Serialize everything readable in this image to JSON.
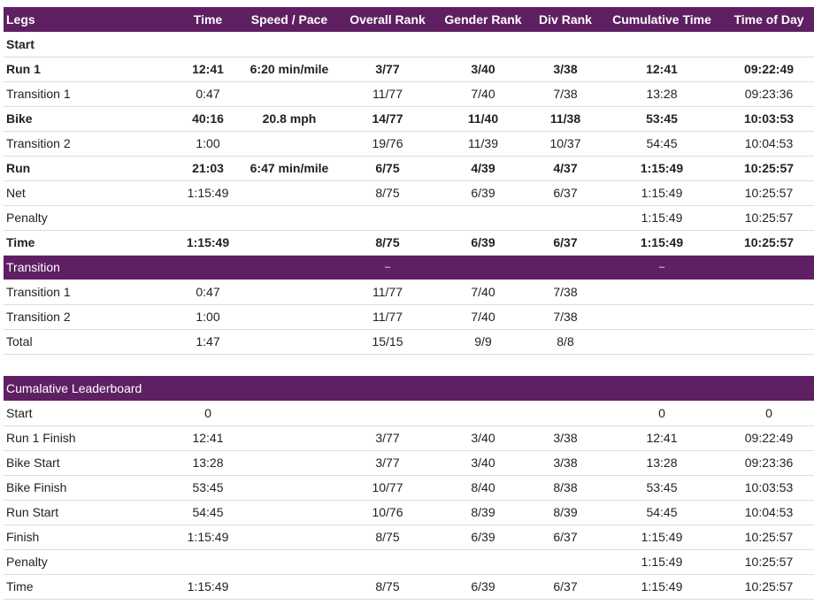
{
  "headers": [
    "Legs",
    "Time",
    "Speed / Pace",
    "Overall Rank",
    "Gender Rank",
    "Div Rank",
    "Cumulative Time",
    "Time of Day"
  ],
  "legs": [
    {
      "label": "Start",
      "bold": true,
      "cells": [
        "",
        "",
        "",
        "",
        "",
        "",
        ""
      ]
    },
    {
      "label": "Run 1",
      "bold": true,
      "cells": [
        "12:41",
        "6:20 min/mile",
        "3/77",
        "3/40",
        "3/38",
        "12:41",
        "09:22:49"
      ]
    },
    {
      "label": "Transition 1",
      "bold": false,
      "cells": [
        "0:47",
        "",
        "11/77",
        "7/40",
        "7/38",
        "13:28",
        "09:23:36"
      ]
    },
    {
      "label": "Bike",
      "bold": true,
      "cells": [
        "40:16",
        "20.8 mph",
        "14/77",
        "11/40",
        "11/38",
        "53:45",
        "10:03:53"
      ]
    },
    {
      "label": "Transition 2",
      "bold": false,
      "cells": [
        "1:00",
        "",
        "19/76",
        "11/39",
        "10/37",
        "54:45",
        "10:04:53"
      ]
    },
    {
      "label": "Run",
      "bold": true,
      "cells": [
        "21:03",
        "6:47 min/mile",
        "6/75",
        "4/39",
        "4/37",
        "1:15:49",
        "10:25:57"
      ]
    },
    {
      "label": "Net",
      "bold": false,
      "cells": [
        "1:15:49",
        "",
        "8/75",
        "6/39",
        "6/37",
        "1:15:49",
        "10:25:57"
      ]
    },
    {
      "label": "Penalty",
      "bold": false,
      "cells": [
        "",
        "",
        "",
        "",
        "",
        "1:15:49",
        "10:25:57"
      ]
    },
    {
      "label": "Time",
      "bold": true,
      "timeBold": true,
      "cells": [
        "1:15:49",
        "",
        "8/75",
        "6/39",
        "6/37",
        "1:15:49",
        "10:25:57"
      ]
    }
  ],
  "transition": {
    "title": "Transition",
    "overall_dash": "–",
    "cumulative_dash": "–",
    "rows": [
      {
        "label": "Transition 1",
        "cells": [
          "0:47",
          "",
          "11/77",
          "7/40",
          "7/38",
          "",
          ""
        ]
      },
      {
        "label": "Transition 2",
        "cells": [
          "1:00",
          "",
          "11/77",
          "7/40",
          "7/38",
          "",
          ""
        ]
      },
      {
        "label": "Total",
        "cells": [
          "1:47",
          "",
          "15/15",
          "9/9",
          "8/8",
          "",
          ""
        ]
      }
    ]
  },
  "leaderboard": {
    "title": "Cumalative Leaderboard",
    "rows": [
      {
        "label": "Start",
        "cells": [
          "0",
          "",
          "",
          "",
          "",
          "0",
          "0"
        ]
      },
      {
        "label": "Run 1 Finish",
        "cells": [
          "12:41",
          "",
          "3/77",
          "3/40",
          "3/38",
          "12:41",
          "09:22:49"
        ]
      },
      {
        "label": "Bike Start",
        "cells": [
          "13:28",
          "",
          "3/77",
          "3/40",
          "3/38",
          "13:28",
          "09:23:36"
        ]
      },
      {
        "label": "Bike Finish",
        "cells": [
          "53:45",
          "",
          "10/77",
          "8/40",
          "8/38",
          "53:45",
          "10:03:53"
        ]
      },
      {
        "label": "Run Start",
        "cells": [
          "54:45",
          "",
          "10/76",
          "8/39",
          "8/39",
          "54:45",
          "10:04:53"
        ]
      },
      {
        "label": "Finish",
        "cells": [
          "1:15:49",
          "",
          "8/75",
          "6/39",
          "6/37",
          "1:15:49",
          "10:25:57"
        ]
      },
      {
        "label": "Penalty",
        "cells": [
          "",
          "",
          "",
          "",
          "",
          "1:15:49",
          "10:25:57"
        ]
      },
      {
        "label": "Time",
        "cells": [
          "1:15:49",
          "",
          "8/75",
          "6/39",
          "6/37",
          "1:15:49",
          "10:25:57"
        ]
      }
    ]
  },
  "colors": {
    "header_bg": "#5f1f63",
    "header_text": "#ffffff",
    "row_border": "#dddddd"
  }
}
